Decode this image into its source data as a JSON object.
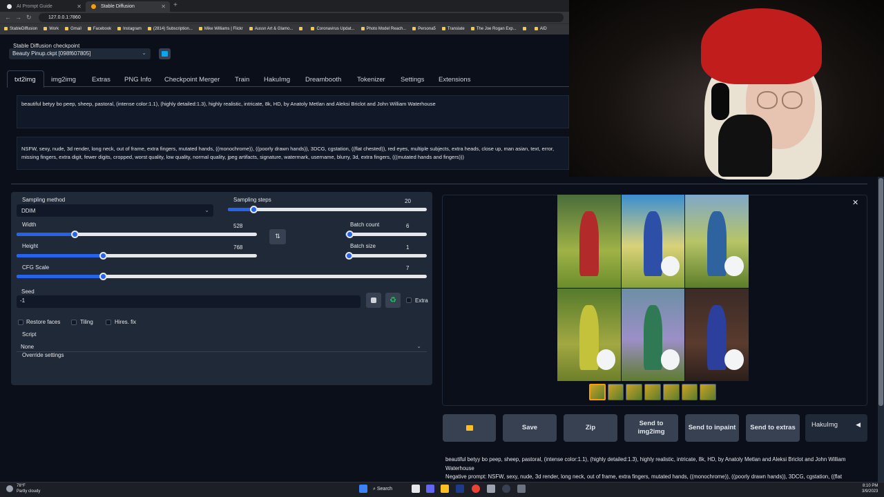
{
  "browser": {
    "tabs": [
      {
        "title": "AI Prompt Guide",
        "active": false
      },
      {
        "title": "Stable Diffusion",
        "active": true
      }
    ],
    "url": "127.0.0.1:7860",
    "bookmarks": [
      "StableDiffusion",
      "Work",
      "Gmail",
      "Facebook",
      "Instagram",
      "(2814) Subscription...",
      "Mike Williams | Flickr",
      "Aussn Art & Glamo...",
      "",
      "Coronavirus Updat...",
      "Photo Model Reach...",
      "Persona5",
      "Translate",
      "The Joe Rogan Exp...",
      "",
      "AID"
    ]
  },
  "checkpoint": {
    "label": "Stable Diffusion checkpoint",
    "value": "Beauty Pinup.ckpt [098f607805]"
  },
  "main_tabs": [
    "txt2img",
    "img2img",
    "Extras",
    "PNG Info",
    "Checkpoint Merger",
    "Train",
    "HakuImg",
    "Dreambooth",
    "Tokenizer",
    "Settings",
    "Extensions"
  ],
  "prompt": "beautiful betyy bo peep, sheep, pastoral, (intense color:1.1), (highly detailed:1.3), highly realistic, intricate, 8k, HD, by Anatoly Metlan and  Aleksi Briclot and  John William Waterhouse",
  "negative_prompt": "NSFW, sexy, nude, 3d render, long neck, out of frame, extra fingers, mutated hands, ((monochrome)), ((poorly drawn hands)), 3DCG, cgstation, ((flat chested)), red eyes, multiple subjects, extra heads, close up, man asian, text, error, missing fingers, extra digit, fewer digits, cropped, worst quality, low quality, normal quality, jpeg artifacts, signature, watermark, username, blurry, 3d, extra fingers, (((mutated hands and fingers)))",
  "settings": {
    "sampling_method_label": "Sampling method",
    "sampling_method": "DDIM",
    "sampling_steps_label": "Sampling steps",
    "sampling_steps": "20",
    "sampling_steps_fraction": 0.13,
    "width_label": "Width",
    "width": "528",
    "width_fraction": 0.24,
    "height_label": "Height",
    "height": "768",
    "height_fraction": 0.36,
    "batch_count_label": "Batch count",
    "batch_count": "6",
    "batch_count_fraction": 0.05,
    "batch_size_label": "Batch size",
    "batch_size": "1",
    "batch_size_fraction": 0.0,
    "cfg_label": "CFG Scale",
    "cfg": "7",
    "cfg_fraction": 0.21,
    "seed_label": "Seed",
    "seed": "-1",
    "extra_label": "Extra",
    "restore_faces": "Restore faces",
    "tiling": "Tiling",
    "hires_fix": "Hires. fix",
    "script_label": "Script",
    "script": "None",
    "override_label": "Override settings"
  },
  "output": {
    "buttons": [
      "Save",
      "Zip",
      "Send to img2img",
      "Send to inpaint",
      "Send to extras"
    ],
    "haku_label": "HakuImg",
    "gen_info_line1": "beautiful betyy bo peep, sheep, pastoral, (intense color:1.1), (highly detailed:1.3), highly realistic, intricate, 8k, HD, by Anatoly Metlan and Aleksi Briclot and John William Waterhouse",
    "gen_info_line2": "Negative prompt: NSFW, sexy, nude, 3d render, long neck, out of frame, extra fingers, mutated hands, ((monochrome)), ((poorly drawn hands)), 3DCG, cgstation, ((flat"
  },
  "taskbar": {
    "temp": "78°F",
    "weather": "Partly cloudy",
    "search": "Search",
    "time": "8:10 PM",
    "date": "3/9/2023"
  },
  "colors": {
    "accent": "#2563eb",
    "background": "#0b0f19",
    "panel": "#1f2937"
  }
}
